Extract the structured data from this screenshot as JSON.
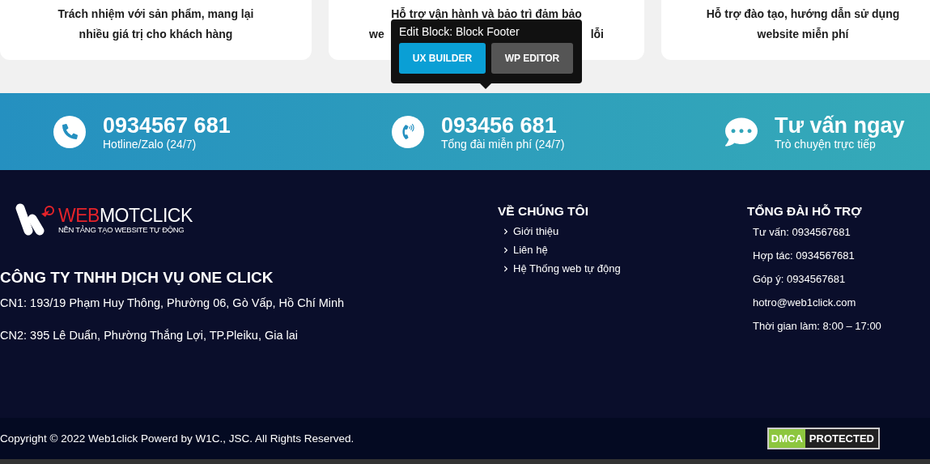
{
  "cards": [
    {
      "lines": [
        "Trách nhiệm với sản phẩm, mang lại",
        "nhiều giá trị cho khách hàng"
      ]
    },
    {
      "lines": [
        "Hỗ trợ vận hành và bảo trì đảm bảo"
      ],
      "fragments": [
        "we",
        "lỗi"
      ]
    },
    {
      "lines": [
        "Hỗ trợ đào tạo, hướng dẫn sử dụng",
        "website miễn phí"
      ]
    }
  ],
  "edit_popup": {
    "title": "Edit Block: Block Footer",
    "buttons": [
      {
        "label": "UX BUILDER",
        "kind": "primary"
      },
      {
        "label": "WP EDITOR",
        "kind": "secondary"
      }
    ]
  },
  "contact_band": [
    {
      "kind": "phone",
      "title": "0934567 681",
      "subtitle": "Hotline/Zalo (24/7)"
    },
    {
      "kind": "telephone",
      "title": "093456 681",
      "subtitle": "Tổng đài miễn phí (24/7)"
    },
    {
      "kind": "chat",
      "title": "Tư vấn ngay",
      "subtitle": "Trò chuyện trực tiếp"
    }
  ],
  "footer": {
    "logo": {
      "word_accent": "WEB",
      "word_rest": "MOTCLICK",
      "tagline": "NỀN TẢNG TẠO WEBSITE TỰ ĐỘNG"
    },
    "company": "CÔNG TY TNHH DỊCH VỤ ONE CLICK",
    "addresses": [
      "CN1: 193/19 Phạm Huy Thông, Phường 06, Gò Vấp, Hồ Chí Minh",
      "CN2: 395 Lê Duẩn, Phường Thắng Lợi, TP.Pleiku, Gia lai"
    ],
    "about": {
      "heading": "VỀ CHÚNG TÔI",
      "links": [
        "Giới thiệu",
        "Liên hệ",
        "Hệ Thống web tự động"
      ]
    },
    "support": {
      "heading": "TỔNG ĐÀI HỖ TRỢ",
      "lines": [
        "Tư vấn: 0934567681",
        "Hợp tác: 0934567681",
        "Góp ý: 0934567681",
        "hotro@web1click.com",
        "Thời gian làm: 8:00 – 17:00"
      ]
    }
  },
  "bottom_bar": {
    "copyright": "Copyright © 2022 Web1click Powerd by W1C., JSC. All Rights Reserved.",
    "badge": {
      "left": "DMCA",
      "right": "PROTECTED"
    }
  }
}
